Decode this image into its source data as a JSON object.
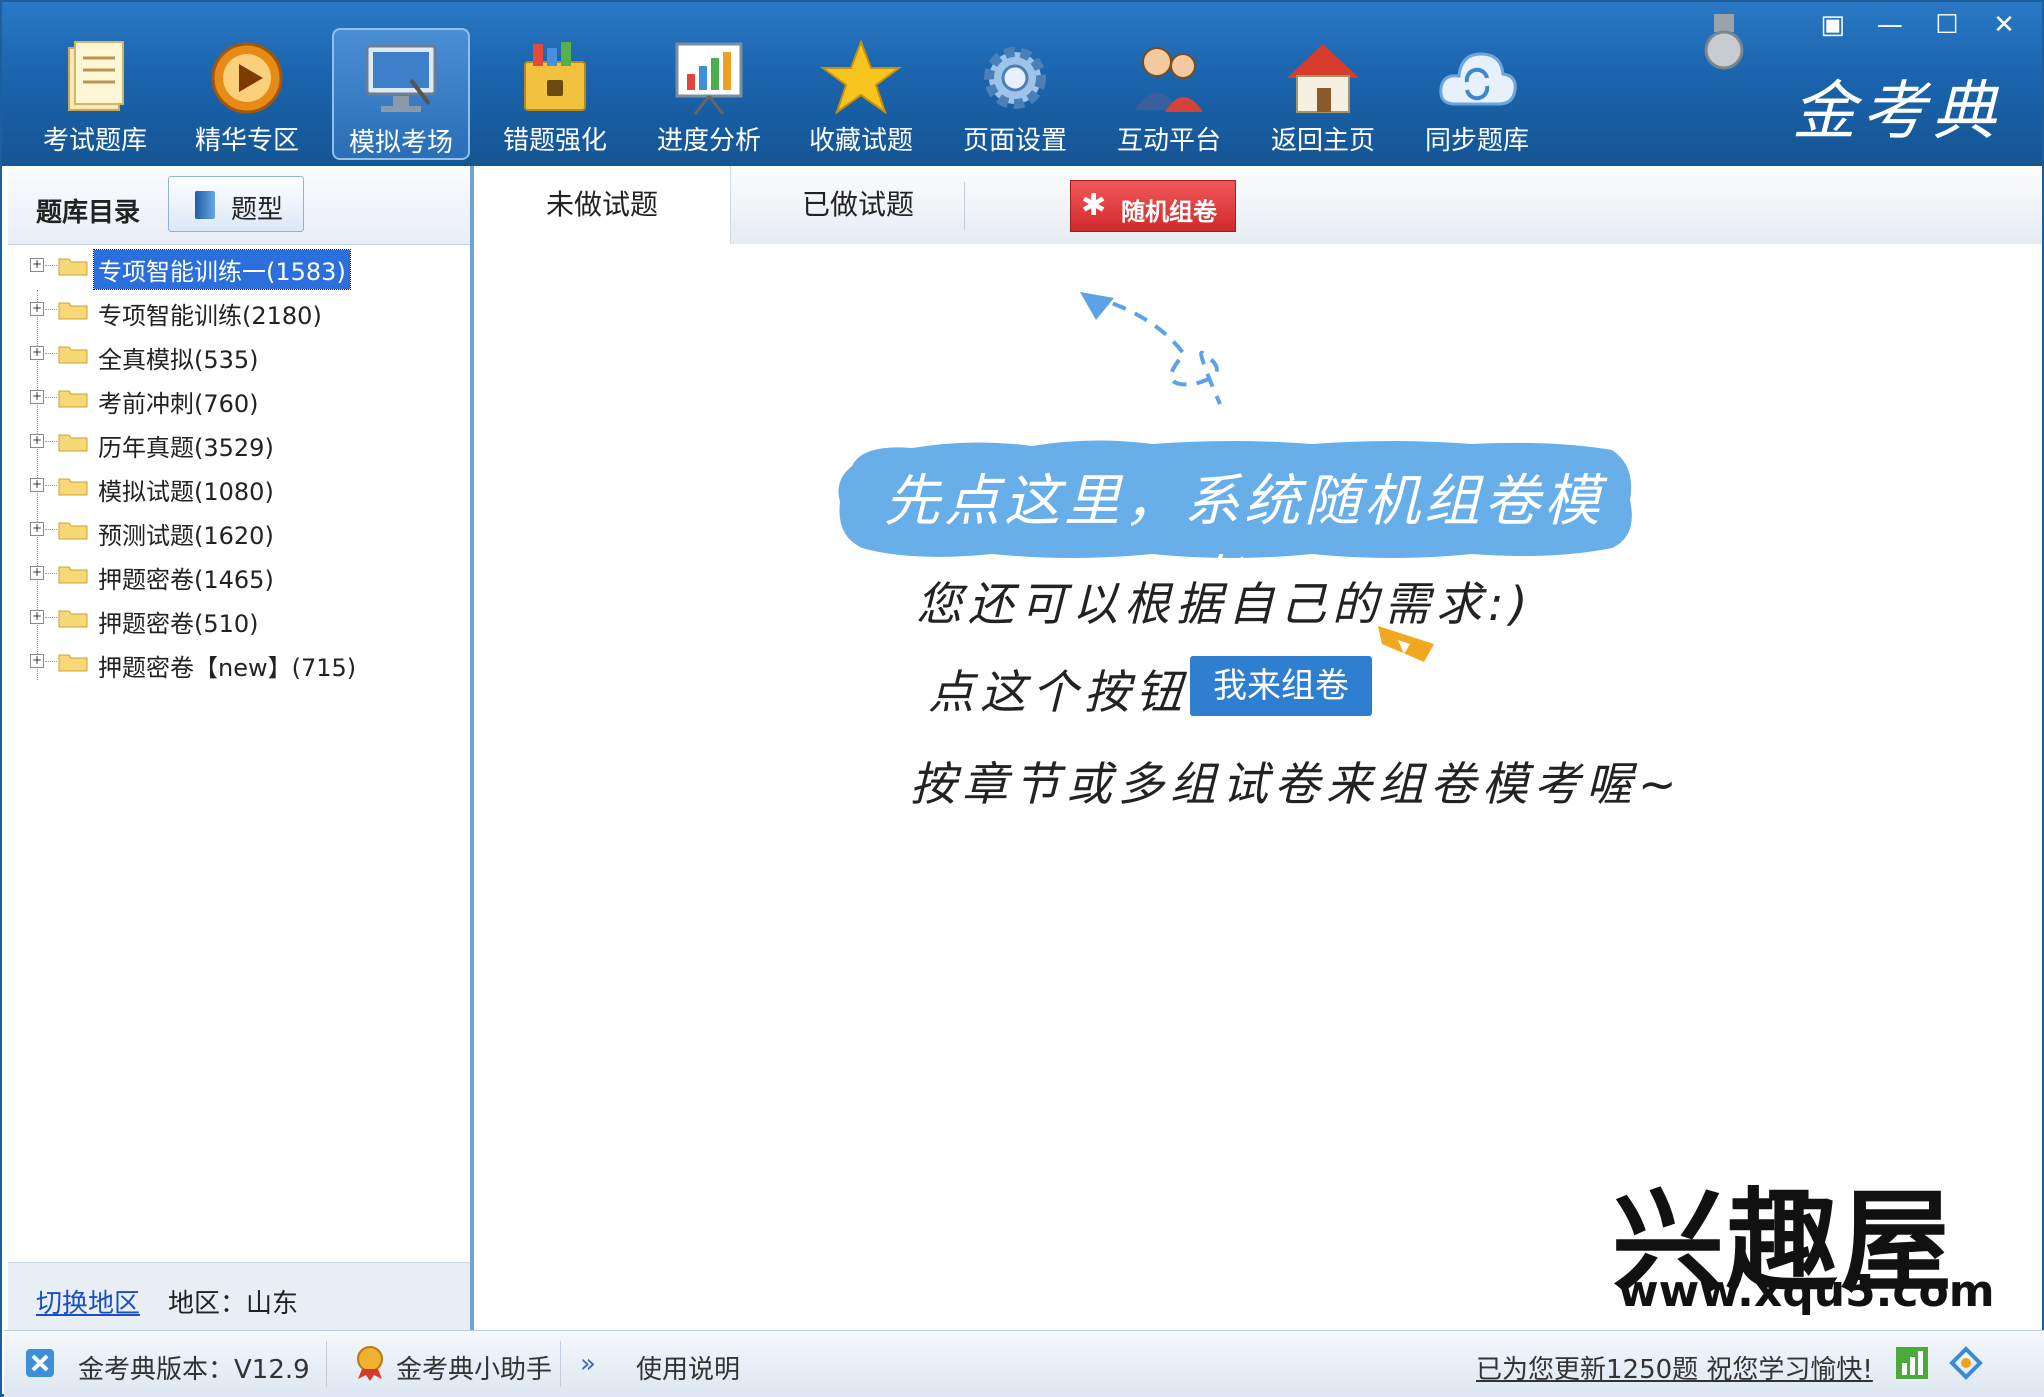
{
  "toolbar": {
    "items": [
      {
        "label": "考试题库",
        "icon": "question-bank-icon"
      },
      {
        "label": "精华专区",
        "icon": "play-icon"
      },
      {
        "label": "模拟考场",
        "icon": "monitor-icon"
      },
      {
        "label": "错题强化",
        "icon": "lock-folder-icon"
      },
      {
        "label": "进度分析",
        "icon": "chart-board-icon"
      },
      {
        "label": "收藏试题",
        "icon": "star-icon"
      },
      {
        "label": "页面设置",
        "icon": "gear-icon"
      },
      {
        "label": "互动平台",
        "icon": "users-icon"
      },
      {
        "label": "返回主页",
        "icon": "home-icon"
      },
      {
        "label": "同步题库",
        "icon": "cloud-sync-icon"
      }
    ],
    "active_index": 2,
    "brand": "金考典"
  },
  "window_controls": {
    "restore": "▣",
    "minimize": "—",
    "maximize": "☐",
    "close": "✕"
  },
  "left": {
    "title": "题库目录",
    "type_button": "题型",
    "tree": [
      "专项智能训练一(1583)",
      "专项智能训练(2180)",
      "全真模拟(535)",
      "考前冲刺(760)",
      "历年真题(3529)",
      "模拟试题(1080)",
      "预测试题(1620)",
      "押题密卷(1465)",
      "押题密卷(510)",
      "押题密卷【new】(715)"
    ],
    "selected_index": 0,
    "switch_region": "切换地区",
    "region": "地区：山东"
  },
  "tabs": {
    "undone": "未做试题",
    "done": "已做试题",
    "random": "随机组卷"
  },
  "content": {
    "cloud_text": "先点这里，系统随机组卷模考！",
    "line1": "您还可以根据自己的需求:)",
    "line2": "点这个按钮",
    "button": "我来组卷",
    "line3": "按章节或多组试卷来组卷模考喔~"
  },
  "watermark": {
    "name": "兴趣屋",
    "url": "www.xqu5.com"
  },
  "status": {
    "version": "金考典版本：V12.9",
    "assistant": "金考典小助手",
    "more": "»",
    "manual": "使用说明",
    "update": "已为您更新1250题 祝您学习愉快!"
  }
}
